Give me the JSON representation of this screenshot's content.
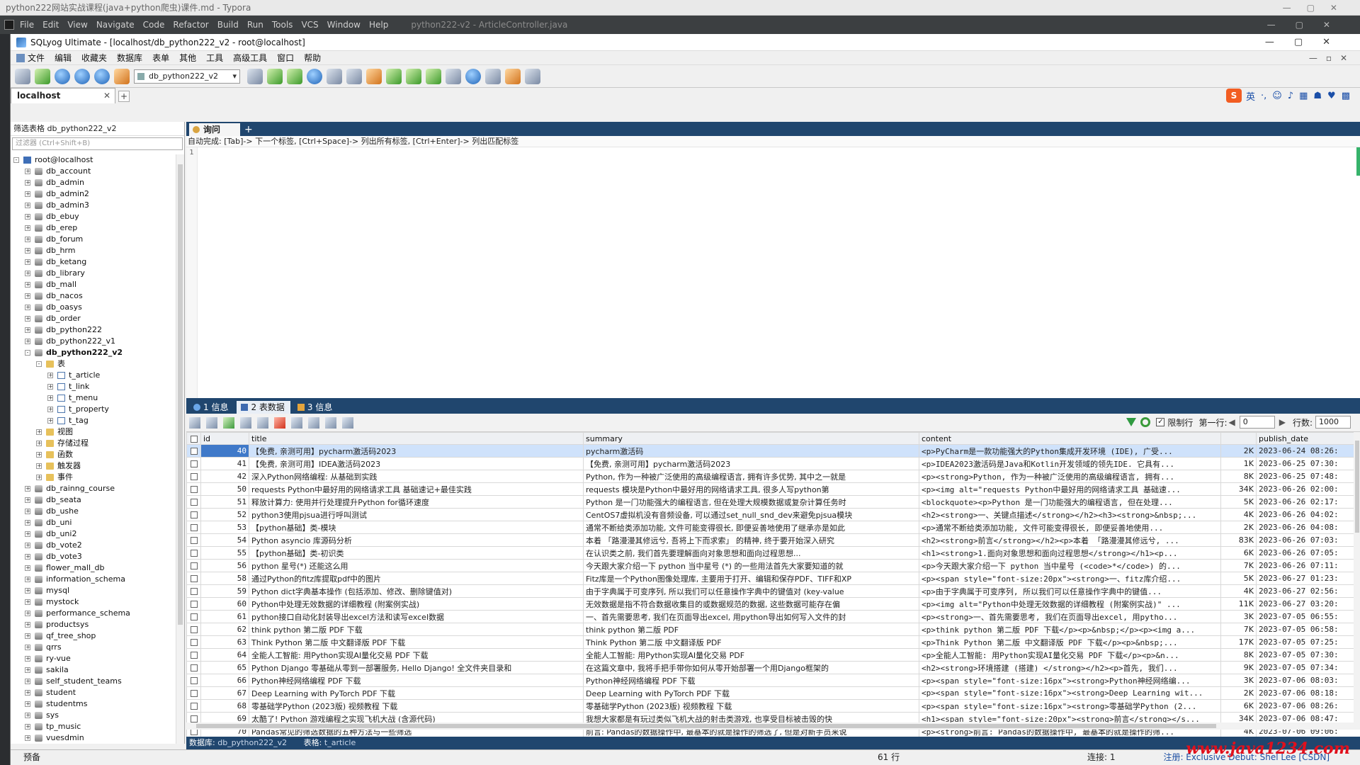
{
  "typora": {
    "title": "python222网站实战课程(java+python爬虫)课件.md - Typora"
  },
  "idea": {
    "menus": [
      "File",
      "Edit",
      "View",
      "Navigate",
      "Code",
      "Refactor",
      "Build",
      "Run",
      "Tools",
      "VCS",
      "Window",
      "Help"
    ],
    "project": "python222-v2 - ArticleController.java"
  },
  "window": {
    "title": "SQLyog Ultimate - [localhost/db_python222_v2 - root@localhost]"
  },
  "menubar": [
    "文件",
    "编辑",
    "收藏夹",
    "数据库",
    "表单",
    "其他",
    "工具",
    "高级工具",
    "窗口",
    "帮助"
  ],
  "toolbar": {
    "db_select": "db_python222_v2"
  },
  "connection_tab": {
    "label": "localhost"
  },
  "left": {
    "filter_label": "筛选表格 db_python222_v2",
    "filter_placeholder": "过滤器 (Ctrl+Shift+B)",
    "tree": [
      {
        "label": "root@localhost",
        "level": 0,
        "kind": "server",
        "pm": "-"
      },
      {
        "label": "db_account",
        "level": 1,
        "kind": "db",
        "pm": "+"
      },
      {
        "label": "db_admin",
        "level": 1,
        "kind": "db",
        "pm": "+"
      },
      {
        "label": "db_admin2",
        "level": 1,
        "kind": "db",
        "pm": "+"
      },
      {
        "label": "db_admin3",
        "level": 1,
        "kind": "db",
        "pm": "+"
      },
      {
        "label": "db_ebuy",
        "level": 1,
        "kind": "db",
        "pm": "+"
      },
      {
        "label": "db_erep",
        "level": 1,
        "kind": "db",
        "pm": "+"
      },
      {
        "label": "db_forum",
        "level": 1,
        "kind": "db",
        "pm": "+"
      },
      {
        "label": "db_hrm",
        "level": 1,
        "kind": "db",
        "pm": "+"
      },
      {
        "label": "db_ketang",
        "level": 1,
        "kind": "db",
        "pm": "+"
      },
      {
        "label": "db_library",
        "level": 1,
        "kind": "db",
        "pm": "+"
      },
      {
        "label": "db_mall",
        "level": 1,
        "kind": "db",
        "pm": "+"
      },
      {
        "label": "db_nacos",
        "level": 1,
        "kind": "db",
        "pm": "+"
      },
      {
        "label": "db_oasys",
        "level": 1,
        "kind": "db",
        "pm": "+"
      },
      {
        "label": "db_order",
        "level": 1,
        "kind": "db",
        "pm": "+"
      },
      {
        "label": "db_python222",
        "level": 1,
        "kind": "db",
        "pm": "+"
      },
      {
        "label": "db_python222_v1",
        "level": 1,
        "kind": "db",
        "pm": "+"
      },
      {
        "label": "db_python222_v2",
        "level": 1,
        "kind": "db",
        "pm": "-",
        "bold": true
      },
      {
        "label": "表",
        "level": 2,
        "kind": "folder",
        "pm": "-"
      },
      {
        "label": "t_article",
        "level": 3,
        "kind": "table",
        "pm": "+"
      },
      {
        "label": "t_link",
        "level": 3,
        "kind": "table",
        "pm": "+"
      },
      {
        "label": "t_menu",
        "level": 3,
        "kind": "table",
        "pm": "+"
      },
      {
        "label": "t_property",
        "level": 3,
        "kind": "table",
        "pm": "+"
      },
      {
        "label": "t_tag",
        "level": 3,
        "kind": "table",
        "pm": "+"
      },
      {
        "label": "视图",
        "level": 2,
        "kind": "folder",
        "pm": "+"
      },
      {
        "label": "存储过程",
        "level": 2,
        "kind": "folder",
        "pm": "+"
      },
      {
        "label": "函数",
        "level": 2,
        "kind": "folder",
        "pm": "+"
      },
      {
        "label": "触发器",
        "level": 2,
        "kind": "folder",
        "pm": "+"
      },
      {
        "label": "事件",
        "level": 2,
        "kind": "folder",
        "pm": "+"
      },
      {
        "label": "db_rainng_course",
        "level": 1,
        "kind": "db",
        "pm": "+"
      },
      {
        "label": "db_seata",
        "level": 1,
        "kind": "db",
        "pm": "+"
      },
      {
        "label": "db_ushe",
        "level": 1,
        "kind": "db",
        "pm": "+"
      },
      {
        "label": "db_uni",
        "level": 1,
        "kind": "db",
        "pm": "+"
      },
      {
        "label": "db_uni2",
        "level": 1,
        "kind": "db",
        "pm": "+"
      },
      {
        "label": "db_vote2",
        "level": 1,
        "kind": "db",
        "pm": "+"
      },
      {
        "label": "db_vote3",
        "level": 1,
        "kind": "db",
        "pm": "+"
      },
      {
        "label": "flower_mall_db",
        "level": 1,
        "kind": "db",
        "pm": "+"
      },
      {
        "label": "information_schema",
        "level": 1,
        "kind": "db",
        "pm": "+"
      },
      {
        "label": "mysql",
        "level": 1,
        "kind": "db",
        "pm": "+"
      },
      {
        "label": "mystock",
        "level": 1,
        "kind": "db",
        "pm": "+"
      },
      {
        "label": "performance_schema",
        "level": 1,
        "kind": "db",
        "pm": "+"
      },
      {
        "label": "productsys",
        "level": 1,
        "kind": "db",
        "pm": "+"
      },
      {
        "label": "qf_tree_shop",
        "level": 1,
        "kind": "db",
        "pm": "+"
      },
      {
        "label": "qrrs",
        "level": 1,
        "kind": "db",
        "pm": "+"
      },
      {
        "label": "ry-vue",
        "level": 1,
        "kind": "db",
        "pm": "+"
      },
      {
        "label": "sakila",
        "level": 1,
        "kind": "db",
        "pm": "+"
      },
      {
        "label": "self_student_teams",
        "level": 1,
        "kind": "db",
        "pm": "+"
      },
      {
        "label": "student",
        "level": 1,
        "kind": "db",
        "pm": "+"
      },
      {
        "label": "studentms",
        "level": 1,
        "kind": "db",
        "pm": "+"
      },
      {
        "label": "sys",
        "level": 1,
        "kind": "db",
        "pm": "+"
      },
      {
        "label": "tp_music",
        "level": 1,
        "kind": "db",
        "pm": "+"
      },
      {
        "label": "vuesdmin",
        "level": 1,
        "kind": "db",
        "pm": "+"
      }
    ]
  },
  "query": {
    "tab": "询问",
    "hint": "自动完成: [Tab]-> 下一个标签, [Ctrl+Space]-> 列出所有标签, [Ctrl+Enter]-> 列出匹配标签",
    "line_number": "1"
  },
  "results": {
    "tabs": [
      "1 信息",
      "2 表数据",
      "3 信息"
    ],
    "limit_label": "限制行",
    "first_row_label": "第一行:",
    "first_row_value": "0",
    "rows_label": "行数:",
    "rows_value": "1000",
    "columns": [
      "id",
      "title",
      "summary",
      "content",
      "",
      "publish_date"
    ],
    "rows": [
      [
        "40",
        "【免费, 亲测可用】pycharm激活码2023",
        "pycharm激活码",
        "<p>PyCharm是一款功能强大的Python集成开发环境 (IDE), 广受...",
        "2K",
        "2023-06-24 08:26:"
      ],
      [
        "41",
        "【免费, 亲测可用】IDEA激活码2023",
        "【免费, 亲测可用】pycharm激活码2023",
        "<p>IDEA2023激活码是Java和Kotlin开发领域的领先IDE. 它具有...",
        "1K",
        "2023-06-25 07:30:"
      ],
      [
        "42",
        "深入Python网络编程: 从基础到实践",
        "Python, 作为一种被广泛使用的高级编程语言, 拥有许多优势, 其中之一就是",
        "<p><strong>Python, 作为一种被广泛使用的高级编程语言, 拥有...",
        "8K",
        "2023-06-25 07:48:"
      ],
      [
        "50",
        "requests Python中最好用的网络请求工具 基础速记+最佳实践",
        "requests 模块是Python中最好用的网络请求工具, 很多人写python第",
        "<p><img alt=\"requests Python中最好用的网络请求工具 基础速...",
        "34K",
        "2023-06-26 02:00:"
      ],
      [
        "51",
        "释放计算力: 使用并行处理提升Python for循环速度",
        "Python 是一门功能强大的编程语言, 但在处理大规模数据或复杂计算任务时",
        "<blockquote><p>Python 是一门功能强大的编程语言, 但在处理...",
        "5K",
        "2023-06-26 02:17:"
      ],
      [
        "52",
        "python3使用pjsua进行呼叫测试",
        "CentOS7虚拟机没有音频设备, 可以通过set_null_snd_dev来避免pjsua模块",
        "<h2><strong>一、关键点描述</strong></h2><h3><strong>&nbsp;...",
        "4K",
        "2023-06-26 04:02:"
      ],
      [
        "53",
        "【python基础】类-模块",
        "通常不断给类添加功能, 文件可能变得很长, 即便妥善地使用了继承亦是如此",
        "<p>通常不断给类添加功能, 文件可能变得很长, 即便妥善地使用...",
        "2K",
        "2023-06-26 04:08:"
      ],
      [
        "54",
        "Python asyncio 库源码分析",
        "本着 「路漫漫其修远兮, 吾将上下而求索」 的精神, 终于要开始深入研究",
        "<h2><strong>前言</strong></h2><p>本着 「路漫漫其修远兮, ...",
        "83K",
        "2023-06-26 07:03:"
      ],
      [
        "55",
        "【python基础】类-初识类",
        "在认识类之前, 我们首先要理解面向对象思想和面向过程思想...",
        "<h1><strong>1.面向对象思想和面向过程思想</strong></h1><p...",
        "6K",
        "2023-06-26 07:05:"
      ],
      [
        "56",
        "python 星号(*) 还能这么用",
        "今天跟大家介绍一下 python 当中星号 (*) 的一些用法首先大家要知道的就",
        "<p>今天跟大家介绍一下 python 当中星号 (<code>*</code>) 的...",
        "7K",
        "2023-06-26 07:11:"
      ],
      [
        "58",
        "通过Python的fitz库提取pdf中的图片",
        "Fitz库是一个Python图像处理库, 主要用于打开、编辑和保存PDF、TIFF和XP",
        "<p><span style=\"font-size:20px\"><strong>一、fitz库介绍...",
        "5K",
        "2023-06-27 01:23:"
      ],
      [
        "59",
        "Python dict字典基本操作 (包括添加、修改、删除键值对)",
        "由于字典属于可变序列, 所以我们可以任意操作字典中的键值对 (key-value",
        "<p>由于字典属于可变序列, 所以我们可以任意操作字典中的键值...",
        "4K",
        "2023-06-27 02:56:"
      ],
      [
        "60",
        "Python中处理无效数据的详细教程 (附案例实战)",
        "无效数据是指不符合数据收集目的或数据规范的数据, 这些数据可能存在偏",
        "<p><img alt=\"Python中处理无效数据的详细教程 (附案例实战)\" ...",
        "11K",
        "2023-06-27 03:20:"
      ],
      [
        "61",
        "python接口自动化封装导出excel方法和读写excel数据",
        "一、首先需要思考, 我们在页面导出excel, 用python导出如何写入文件的封",
        "<p><strong>一、首先需要思考, 我们在页面导出excel, 用pytho...",
        "3K",
        "2023-07-05 06:55:"
      ],
      [
        "62",
        "think python 第二版 PDF 下载",
        "think python 第二版 PDF",
        "<p>think python 第二版 PDF 下载</p><p>&nbsp;</p><p><img a...",
        "7K",
        "2023-07-05 06:58:"
      ],
      [
        "63",
        "Think Python 第二版 中文翻译版 PDF 下载",
        "Think Python 第二版 中文翻译版 PDF",
        "<p>Think Python 第二版 中文翻译版 PDF 下载</p><p>&nbsp;...",
        "17K",
        "2023-07-05 07:25:"
      ],
      [
        "64",
        "全能人工智能: 用Python实现AI量化交易 PDF 下载",
        "全能人工智能: 用Python实现AI量化交易 PDF",
        "<p>全能人工智能: 用Python实现AI量化交易 PDF 下载</p><p>&n...",
        "8K",
        "2023-07-05 07:30:"
      ],
      [
        "65",
        "Python Django 零基础从零到一部署服务, Hello Django! 全文件夹目录和",
        "在这篇文章中, 我将手把手带你如何从零开始部署一个用Django框架的",
        "<h2><strong>环境搭建 (搭建) </strong></h2><p>首先, 我们...",
        "9K",
        "2023-07-05 07:34:"
      ],
      [
        "66",
        "Python神经网络编程 PDF 下载",
        "Python神经网络编程 PDF 下载",
        "<p><span style=\"font-size:16px\"><strong>Python神经网络编...",
        "3K",
        "2023-07-06 08:03:"
      ],
      [
        "67",
        "Deep Learning with PyTorch PDF 下载",
        "Deep Learning with PyTorch PDF 下载",
        "<p><span style=\"font-size:16px\"><strong>Deep Learning wit...",
        "2K",
        "2023-07-06 08:18:"
      ],
      [
        "68",
        "零基础学Python (2023版) 视频教程 下载",
        "零基础学Python (2023版) 视频教程 下载",
        "<p><span style=\"font-size:16px\"><strong>零基础学Python (2...",
        "6K",
        "2023-07-06 08:26:"
      ],
      [
        "69",
        "太酷了! Python 游戏编程之实现飞机大战 (含源代码)",
        "我想大家都是有玩过类似飞机大战的射击类游戏, 也享受目标被击毁的快",
        "<h1><span style=\"font-size:20px\"><strong>前言</strong></s...",
        "34K",
        "2023-07-06 08:47:"
      ],
      [
        "70",
        "Pandas常见的筛选数据的五种方法与一些筛选",
        "前言: Pandas的数据操作中, 最基本的就是操作的筛选了, 但是对新手员来说",
        "<p><strong>前言: Pandas的数据操作中, 最基本的就是操作的筛...",
        "4K",
        "2023-07-06 09:06:"
      ]
    ]
  },
  "dbbar": {
    "db_label": "数据库:",
    "db_value": "db_python222_v2",
    "table_label": "表格:",
    "table_value": "t_article"
  },
  "status": {
    "left": "预备",
    "rows": "61 行",
    "connection": "连接: 1",
    "registered": "注册: Exclusive Debut: Shel Lee [CSDN]"
  },
  "watermark": "www.java1234.com"
}
